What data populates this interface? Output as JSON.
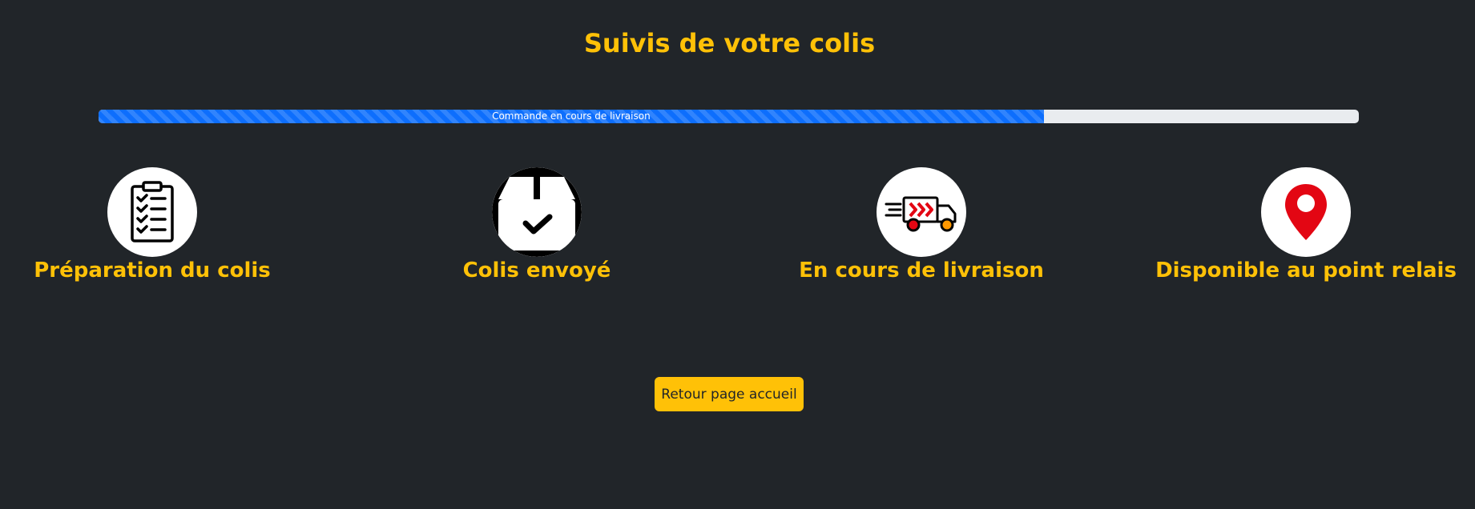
{
  "page": {
    "title": "Suivis de votre colis",
    "background_color": "#212529",
    "accent_color": "#ffc107"
  },
  "progress": {
    "label": "Commande en cours de livraison",
    "percent": 75,
    "fill_color": "#0d6efd",
    "track_color": "#e9ecef",
    "striped": true
  },
  "steps": [
    {
      "label": "Préparation du colis",
      "icon": "clipboard-checklist-icon"
    },
    {
      "label": "Colis envoyé",
      "icon": "package-check-icon"
    },
    {
      "label": "En cours de livraison",
      "icon": "delivery-truck-icon"
    },
    {
      "label": "Disponible au point relais",
      "icon": "map-pin-icon"
    }
  ],
  "actions": {
    "home_button_label": "Retour page accueil"
  }
}
